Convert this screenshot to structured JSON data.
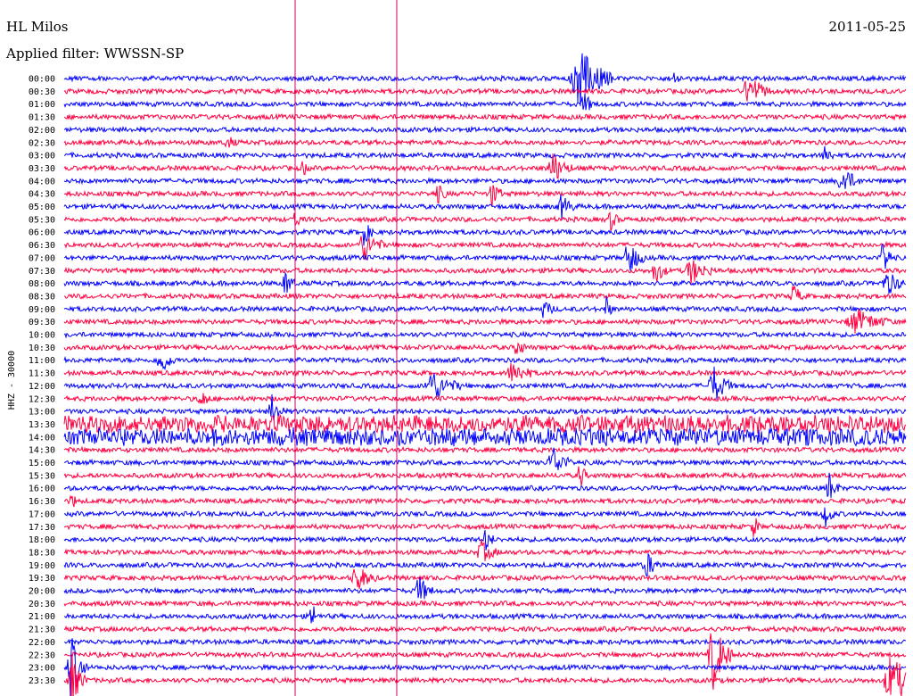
{
  "header": {
    "station": "HL Milos",
    "filter": "Applied filter: WWSSN-SP",
    "date": "2011-05-25"
  },
  "chart_data": {
    "type": "line",
    "title": "HL Milos",
    "subtitle": "Applied filter: WWSSN-SP",
    "date": "2011-05-25",
    "ylabel": "HHZ - 30000",
    "row_labels": [
      "00:00",
      "00:30",
      "01:00",
      "01:30",
      "02:00",
      "02:30",
      "03:00",
      "03:30",
      "04:00",
      "04:30",
      "05:00",
      "05:30",
      "06:00",
      "06:30",
      "07:00",
      "07:30",
      "08:00",
      "08:30",
      "09:00",
      "09:30",
      "10:00",
      "10:30",
      "11:00",
      "11:30",
      "12:00",
      "12:30",
      "13:00",
      "13:30",
      "14:00",
      "14:30",
      "15:00",
      "15:30",
      "16:00",
      "16:30",
      "17:00",
      "17:30",
      "18:00",
      "18:30",
      "19:00",
      "19:30",
      "20:00",
      "20:30",
      "21:00",
      "21:30",
      "22:00",
      "22:30",
      "23:00",
      "23:30"
    ],
    "colors": [
      "#0000ff",
      "#ff0040"
    ],
    "markers": [
      "#cc0066"
    ]
  }
}
